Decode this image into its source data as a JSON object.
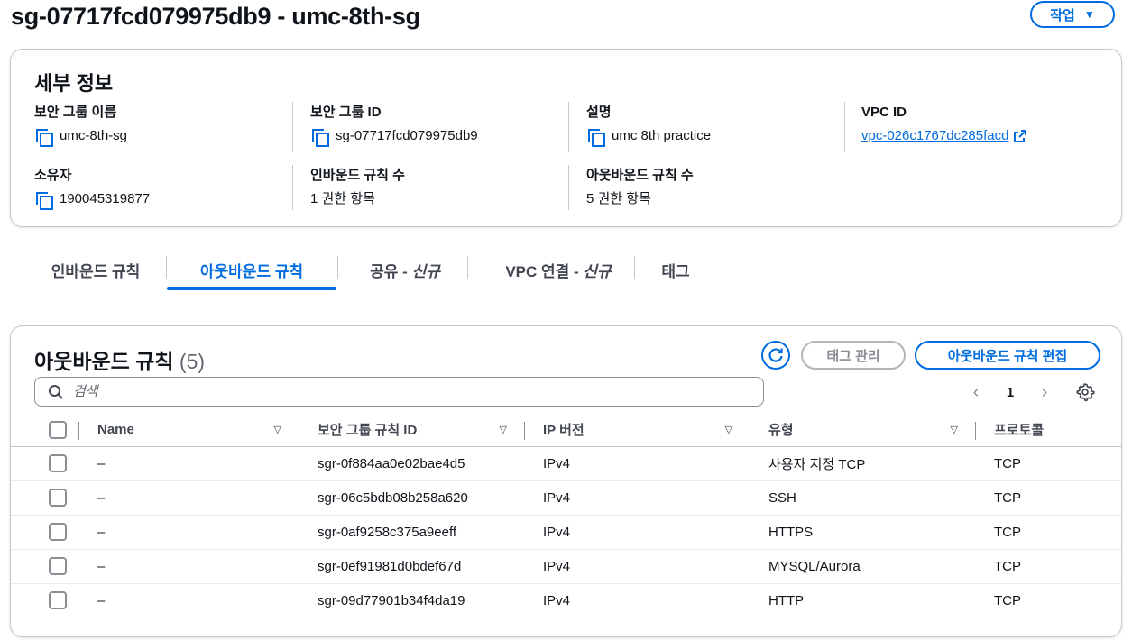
{
  "header": {
    "title": "sg-07717fcd079975db9 - umc-8th-sg",
    "action_label": "작업",
    "action_caret": "▼"
  },
  "details": {
    "title": "세부 정보",
    "sg_name_label": "보안 그룹 이름",
    "sg_name_value": "umc-8th-sg",
    "sg_id_label": "보안 그룹 ID",
    "sg_id_value": "sg-07717fcd079975db9",
    "description_label": "설명",
    "description_value": "umc 8th practice",
    "vpc_id_label": "VPC ID",
    "vpc_id_value": "vpc-026c1767dc285facd",
    "owner_label": "소유자",
    "owner_value": "190045319877",
    "inbound_count_label": "인바운드 규칙 수",
    "inbound_count_value": "1 권한 항목",
    "outbound_count_label": "아웃바운드 규칙 수",
    "outbound_count_value": "5 권한 항목"
  },
  "tabs": [
    {
      "label": "인바운드 규칙",
      "suffix": ""
    },
    {
      "label": "아웃바운드 규칙",
      "suffix": "",
      "active": true
    },
    {
      "label": "공유 - ",
      "suffix": "신규"
    },
    {
      "label": "VPC 연결 - ",
      "suffix": "신규"
    },
    {
      "label": "태그",
      "suffix": ""
    }
  ],
  "rules": {
    "title": "아웃바운드 규칙",
    "count": "(5)",
    "manage_tags_label": "태그 관리",
    "edit_label": "아웃바운드 규칙 편집",
    "search_placeholder": "검색",
    "page": "1",
    "columns": [
      "Name",
      "보안 그룹 규칙 ID",
      "IP 버전",
      "유형",
      "프로토콜"
    ],
    "rows": [
      {
        "name": "–",
        "id": "sgr-0f884aa0e02bae4d5",
        "ip": "IPv4",
        "type": "사용자 지정 TCP",
        "protocol": "TCP"
      },
      {
        "name": "–",
        "id": "sgr-06c5bdb08b258a620",
        "ip": "IPv4",
        "type": "SSH",
        "protocol": "TCP"
      },
      {
        "name": "–",
        "id": "sgr-0af9258c375a9eeff",
        "ip": "IPv4",
        "type": "HTTPS",
        "protocol": "TCP"
      },
      {
        "name": "–",
        "id": "sgr-0ef91981d0bdef67d",
        "ip": "IPv4",
        "type": "MYSQL/Aurora",
        "protocol": "TCP"
      },
      {
        "name": "–",
        "id": "sgr-09d77901b34f4da19",
        "ip": "IPv4",
        "type": "HTTP",
        "protocol": "TCP"
      }
    ]
  },
  "colors": {
    "accent": "#006ce0",
    "border": "#c6c6cd",
    "disabled": "#b4b4bb"
  }
}
